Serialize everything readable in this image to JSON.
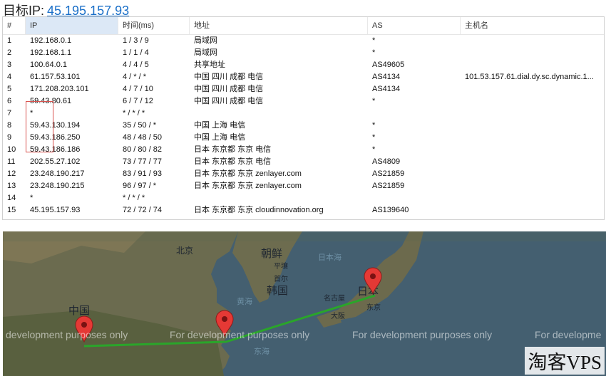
{
  "header": {
    "label": "目标IP:",
    "ip": "45.195.157.93"
  },
  "table": {
    "columns": [
      "#",
      "IP",
      "时间(ms)",
      "地址",
      "AS",
      "主机名"
    ],
    "rows": [
      [
        "1",
        "192.168.0.1",
        "1 / 3 / 9",
        "局域网",
        "*",
        ""
      ],
      [
        "2",
        "192.168.1.1",
        "1 / 1 / 4",
        "局域网",
        "*",
        ""
      ],
      [
        "3",
        "100.64.0.1",
        "4 / 4 / 5",
        "共享地址",
        "AS49605",
        ""
      ],
      [
        "4",
        "61.157.53.101",
        "4 / * / *",
        "中国 四川 成都 电信",
        "AS4134",
        "101.53.157.61.dial.dy.sc.dynamic.1..."
      ],
      [
        "5",
        "171.208.203.101",
        "4 / 7 / 10",
        "中国 四川 成都 电信",
        "AS4134",
        ""
      ],
      [
        "6",
        "59.43.80.61",
        "6 / 7 / 12",
        "中国 四川 成都 电信",
        "*",
        ""
      ],
      [
        "7",
        "*",
        "* / * / *",
        "",
        "",
        ""
      ],
      [
        "8",
        "59.43.130.194",
        "35 / 50 / *",
        "中国 上海 电信",
        "*",
        ""
      ],
      [
        "9",
        "59.43.186.250",
        "48 / 48 / 50",
        "中国 上海 电信",
        "*",
        ""
      ],
      [
        "10",
        "59.43.186.186",
        "80 / 80 / 82",
        "日本 东京都 东京 电信",
        "*",
        ""
      ],
      [
        "11",
        "202.55.27.102",
        "73 / 77 / 77",
        "日本 东京都 东京 电信",
        "AS4809",
        ""
      ],
      [
        "12",
        "23.248.190.217",
        "83 / 91 / 93",
        "日本 东京都 东京 zenlayer.com",
        "AS21859",
        ""
      ],
      [
        "13",
        "23.248.190.215",
        "96 / 97 / *",
        "日本 东京都 东京 zenlayer.com",
        "AS21859",
        ""
      ],
      [
        "14",
        "*",
        "* / * / *",
        "",
        "",
        ""
      ],
      [
        "15",
        "45.195.157.93",
        "72 / 72 / 74",
        "日本 东京都 东京 cloudinnovation.org",
        "AS139640",
        ""
      ]
    ]
  },
  "map": {
    "labels": {
      "beijing": "北京",
      "korea_n": "朝鲜",
      "pyongyang": "平壤",
      "seoul": "首尔",
      "korea_s": "韩国",
      "sea_japan": "日本海",
      "yellow_sea": "黄海",
      "east_sea": "东海",
      "china": "中国",
      "nagoya": "名古屋",
      "osaka": "大阪",
      "japan": "日本",
      "tokyo": "东京"
    },
    "watermarks": [
      "development purposes only",
      "For development purposes only",
      "For development purposes only",
      "For developme"
    ],
    "route_color": "#2aa52a",
    "pin_color": "#e53935"
  },
  "brand": "淘客VPS"
}
